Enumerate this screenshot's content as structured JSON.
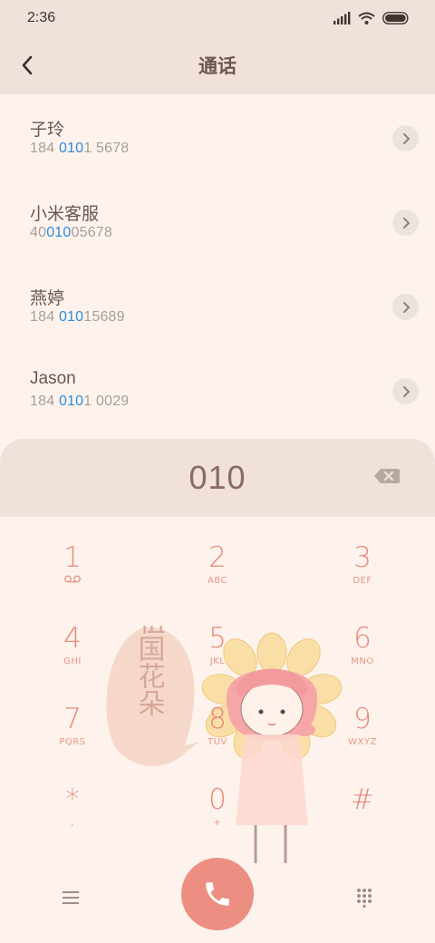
{
  "status": {
    "time": "2:36"
  },
  "header": {
    "title": "通话"
  },
  "results": [
    {
      "name": "子玲",
      "number_before": "184 ",
      "number_match": "010",
      "number_after": "1 5678"
    },
    {
      "name": "小米客服",
      "number_before": "40",
      "number_match": "010",
      "number_after": "05678"
    },
    {
      "name": "燕婷",
      "number_before": "184 ",
      "number_match": "010",
      "number_after": "15689"
    },
    {
      "name": "Jason",
      "number_before": "184 ",
      "number_match": "010",
      "number_after": "1 0029"
    }
  ],
  "dial": {
    "input": "010"
  },
  "keypad": [
    {
      "digit": "1",
      "letters": ""
    },
    {
      "digit": "2",
      "letters": "ABC"
    },
    {
      "digit": "3",
      "letters": "DEF"
    },
    {
      "digit": "4",
      "letters": "GHI"
    },
    {
      "digit": "5",
      "letters": "JKL"
    },
    {
      "digit": "6",
      "letters": "MNO"
    },
    {
      "digit": "7",
      "letters": "PQRS"
    },
    {
      "digit": "8",
      "letters": "TUV"
    },
    {
      "digit": "9",
      "letters": "WXYZ"
    },
    {
      "digit": "*",
      "letters": ","
    },
    {
      "digit": "0",
      "letters": "+"
    },
    {
      "digit": "#",
      "letters": ""
    }
  ],
  "decoration": {
    "text": "祖国花朵"
  },
  "colors": {
    "accent": "#ec8f82",
    "highlight": "#2d8be0",
    "background": "#fdf3ec",
    "bar": "#f0e1da"
  }
}
